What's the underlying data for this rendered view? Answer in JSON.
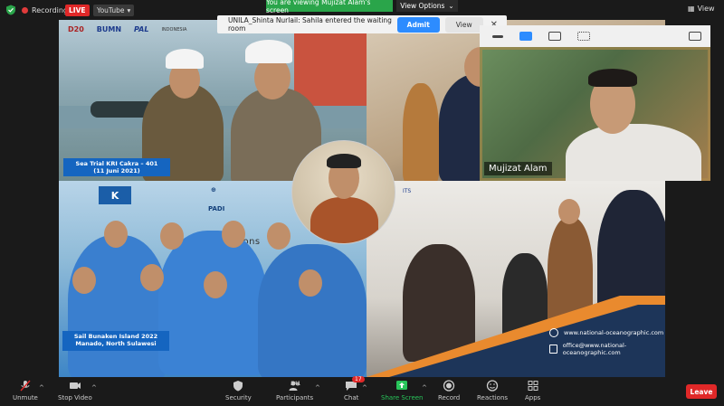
{
  "topbar": {
    "recording_label": "Recording",
    "live_badge": "LIVE",
    "youtube_label": "YouTube",
    "viewing_banner": "You are viewing Mujizat Alam's screen",
    "view_options": "View Options",
    "view_label": "View"
  },
  "notification": {
    "message": "UNILA_Shinta Nurlail: Sahila entered the waiting room",
    "admit_label": "Admit",
    "view_label": "View"
  },
  "shared_content": {
    "logos": [
      "D20",
      "BUMN",
      "PAL",
      "INDONESIA"
    ],
    "caption_top_line1": "Sea Trial KRI Cakra – 401",
    "caption_top_line2": "(11 Juni 2021)",
    "caption_bottom_line1": "Sail Bunaken Island 2022",
    "caption_bottom_line2": "Manado, North Sulawesi",
    "padi_label": "PADI",
    "four_seasons": "Four Seasons",
    "its_label": "ITS",
    "website": "www.national-oceanographic.com",
    "email": "office@www.national-oceanographic.com"
  },
  "participant": {
    "name": "Mujizat Alam"
  },
  "toolbar": {
    "unmute": "Unmute",
    "stop_video": "Stop Video",
    "security": "Security",
    "participants": "Participants",
    "participants_count": "241",
    "chat": "Chat",
    "chat_badge": "17",
    "share_screen": "Share Screen",
    "record": "Record",
    "reactions": "Reactions",
    "apps": "Apps",
    "leave": "Leave"
  },
  "colors": {
    "accent_blue": "#2d8cff",
    "share_green": "#28c55a",
    "leave_red": "#e02828"
  }
}
